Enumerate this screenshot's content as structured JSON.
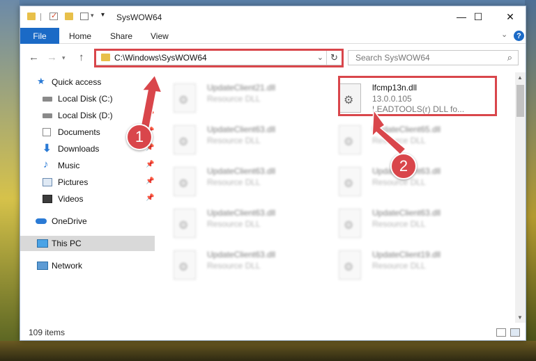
{
  "window": {
    "title": "SysWOW64",
    "controls": {
      "minimize": "—",
      "maximize": "☐",
      "close": "✕"
    }
  },
  "ribbon": {
    "tabs": [
      "File",
      "Home",
      "Share",
      "View"
    ],
    "help": "?"
  },
  "address_bar": {
    "path": "C:\\Windows\\SysWOW64",
    "search_placeholder": "Search SysWOW64"
  },
  "nav_pane": {
    "items": [
      {
        "label": "Quick access",
        "icon": "star-icon",
        "pinned": false
      },
      {
        "label": "Local Disk (C:)",
        "icon": "drive-icon",
        "pinned": true
      },
      {
        "label": "Local Disk (D:)",
        "icon": "drive-icon",
        "pinned": true
      },
      {
        "label": "Documents",
        "icon": "documents-icon",
        "pinned": true
      },
      {
        "label": "Downloads",
        "icon": "download-icon",
        "pinned": true
      },
      {
        "label": "Music",
        "icon": "music-icon",
        "pinned": true
      },
      {
        "label": "Pictures",
        "icon": "pictures-icon",
        "pinned": true
      },
      {
        "label": "Videos",
        "icon": "videos-icon",
        "pinned": true
      },
      {
        "label": "OneDrive",
        "icon": "cloud-icon",
        "pinned": false
      },
      {
        "label": "This PC",
        "icon": "computer-icon",
        "pinned": false,
        "selected": true
      },
      {
        "label": "Network",
        "icon": "network-icon",
        "pinned": false
      }
    ]
  },
  "files": {
    "highlighted": {
      "name": "lfcmp13n.dll",
      "version": "13.0.0.105",
      "description": "LEADTOOLS(r) DLL fo..."
    },
    "left_column": [
      {
        "name": "UpdateClient21.dll",
        "type": "Resource DLL"
      },
      {
        "name": "UpdateClient63.dll",
        "type": "Resource DLL"
      },
      {
        "name": "UpdateClient63.dll",
        "type": "Resource DLL"
      },
      {
        "name": "UpdateClient63.dll",
        "type": "Resource DLL"
      },
      {
        "name": "UpdateClient63.dll",
        "type": "Resource DLL"
      }
    ],
    "right_column": [
      {
        "name": "UpdateClient65.dll",
        "type": "Resource DLL"
      },
      {
        "name": "UpdateClient63.dll",
        "type": "Resource DLL"
      },
      {
        "name": "UpdateClient63.dll",
        "type": "Resource DLL"
      },
      {
        "name": "UpdateClient19.dll",
        "type": "Resource DLL"
      }
    ]
  },
  "status_bar": {
    "count": "109 items"
  },
  "callouts": [
    "1",
    "2"
  ],
  "colors": {
    "accent": "#1b6ac6",
    "highlight": "#d9464b",
    "selection": "#d9d9d9"
  }
}
